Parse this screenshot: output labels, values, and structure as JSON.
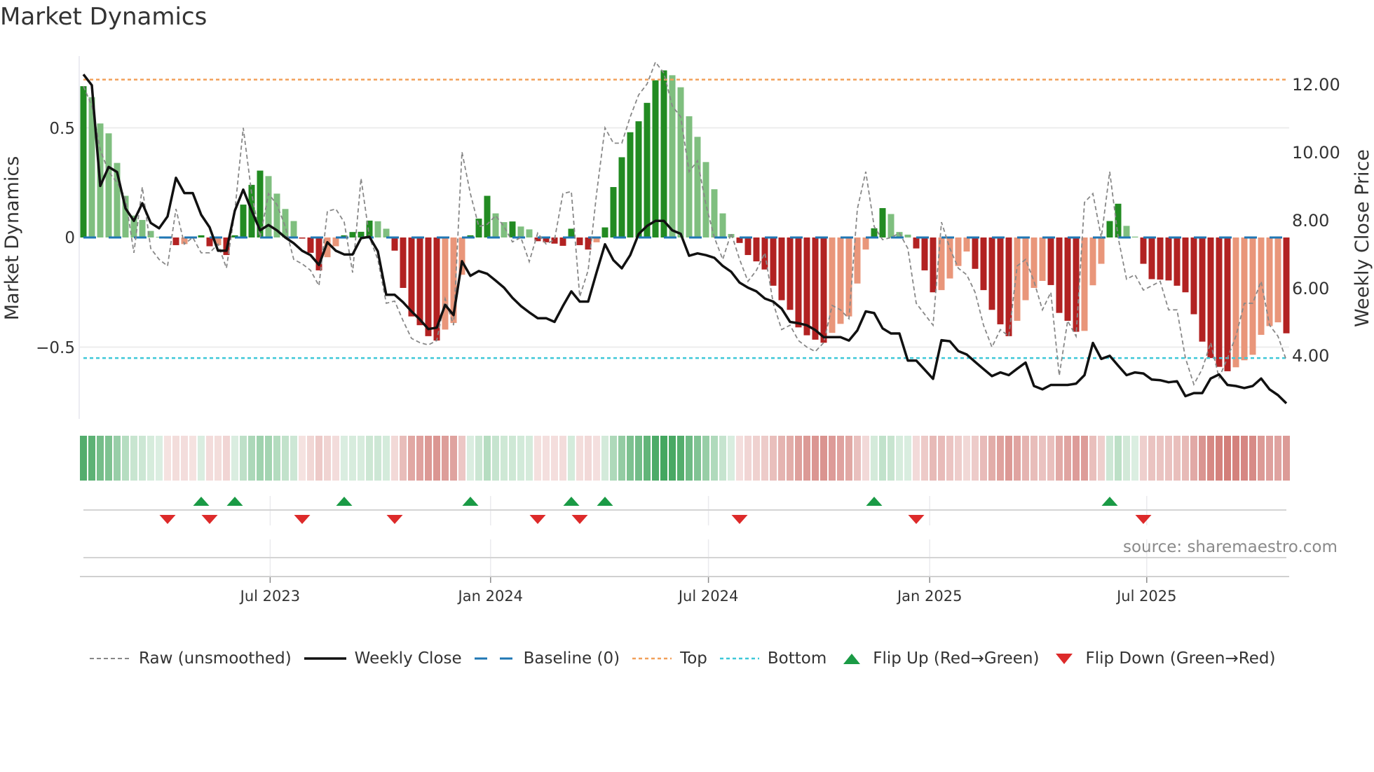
{
  "title": "Market Dynamics",
  "source": "source: sharemaestro.com",
  "colors": {
    "bar_up_strong": "#228b22",
    "bar_up_weak": "#7fbf7f",
    "bar_down_strong": "#b22222",
    "bar_down_weak": "#e9967a",
    "raw": "#888888",
    "close": "#111111",
    "baseline": "#1f77b4",
    "top": "#f2a05a",
    "bottom": "#3ec8d8",
    "flip_up": "#1a9a45",
    "flip_down": "#dd2a2a",
    "strip_green": "#3da35a",
    "strip_red": "#c8605a"
  },
  "legend": [
    {
      "key": "raw",
      "label": "Raw (unsmoothed)"
    },
    {
      "key": "close",
      "label": "Weekly Close"
    },
    {
      "key": "baseline",
      "label": "Baseline (0)"
    },
    {
      "key": "top",
      "label": "Top"
    },
    {
      "key": "bottom",
      "label": "Bottom"
    },
    {
      "key": "flip_up",
      "label": "Flip Up (Red→Green)"
    },
    {
      "key": "flip_down",
      "label": "Flip Down (Green→Red)"
    }
  ],
  "chart_data": {
    "type": "bar",
    "title": "Market Dynamics",
    "ylabel": "Market Dynamics",
    "y2label": "Weekly Close Price",
    "xlabel": "",
    "ylim": [
      -0.66,
      0.82
    ],
    "y2lim": [
      2.2,
      13.1
    ],
    "yticks": [
      {
        "value": 0.5,
        "label": "0.5"
      },
      {
        "value": 0,
        "label": "0"
      },
      {
        "value": -0.5,
        "label": "−0.5"
      }
    ],
    "y2ticks": [
      {
        "value": 12,
        "label": "12.00"
      },
      {
        "value": 10,
        "label": "10.00"
      },
      {
        "value": 8,
        "label": "8.00"
      },
      {
        "value": 6,
        "label": "6.00"
      },
      {
        "value": 4,
        "label": "4.00"
      }
    ],
    "xticks": [
      {
        "week": 22.2,
        "label": "Jul 2023"
      },
      {
        "week": 48.4,
        "label": "Jan 2024"
      },
      {
        "week": 74.3,
        "label": "Jul 2024"
      },
      {
        "week": 100.6,
        "label": "Jan 2025"
      },
      {
        "week": 126.4,
        "label": "Jul 2025"
      }
    ],
    "top_level": 0.72,
    "bottom_level": -0.55,
    "baseline": 0,
    "grid": true,
    "legend_position": "bottom",
    "momentum": [
      0.69,
      0.64,
      0.52,
      0.475,
      0.34,
      0.19,
      0.1,
      0.08,
      0.03,
      0.003,
      -0.005,
      -0.035,
      -0.03,
      -0.005,
      0.01,
      -0.04,
      -0.035,
      -0.08,
      0.01,
      0.15,
      0.24,
      0.305,
      0.28,
      0.2,
      0.13,
      0.075,
      -0.005,
      -0.07,
      -0.15,
      -0.09,
      -0.04,
      0.01,
      0.025,
      0.026,
      0.077,
      0.074,
      0.04,
      -0.06,
      -0.23,
      -0.36,
      -0.4,
      -0.45,
      -0.47,
      -0.42,
      -0.39,
      -0.17,
      0.01,
      0.086,
      0.19,
      0.11,
      0.07,
      0.073,
      0.05,
      0.037,
      -0.017,
      -0.022,
      -0.028,
      -0.038,
      0.04,
      -0.035,
      -0.055,
      -0.022,
      0.046,
      0.23,
      0.366,
      0.48,
      0.53,
      0.614,
      0.717,
      0.762,
      0.74,
      0.685,
      0.553,
      0.459,
      0.344,
      0.22,
      0.11,
      0.016,
      -0.025,
      -0.08,
      -0.109,
      -0.146,
      -0.22,
      -0.286,
      -0.33,
      -0.41,
      -0.446,
      -0.466,
      -0.48,
      -0.435,
      -0.394,
      -0.36,
      -0.21,
      -0.055,
      0.042,
      0.134,
      0.107,
      0.025,
      0.013,
      -0.05,
      -0.15,
      -0.25,
      -0.24,
      -0.187,
      -0.13,
      -0.064,
      -0.143,
      -0.24,
      -0.33,
      -0.396,
      -0.45,
      -0.38,
      -0.286,
      -0.23,
      -0.198,
      -0.217,
      -0.344,
      -0.38,
      -0.43,
      -0.426,
      -0.218,
      -0.12,
      0.075,
      0.154,
      0.053,
      0.004,
      -0.12,
      -0.19,
      -0.192,
      -0.196,
      -0.22,
      -0.25,
      -0.35,
      -0.475,
      -0.55,
      -0.59,
      -0.61,
      -0.592,
      -0.56,
      -0.535,
      -0.444,
      -0.404,
      -0.387,
      -0.437
    ],
    "raw": [
      0.69,
      0.6,
      0.4,
      0.3,
      0.25,
      0.18,
      -0.07,
      0.23,
      -0.05,
      -0.1,
      -0.13,
      0.13,
      -0.03,
      0.0,
      -0.07,
      -0.07,
      -0.03,
      -0.14,
      0.12,
      0.5,
      0.2,
      0.0,
      0.2,
      0.15,
      0.05,
      -0.1,
      -0.12,
      -0.15,
      -0.22,
      0.12,
      0.13,
      0.07,
      -0.16,
      0.27,
      0.0,
      -0.1,
      -0.3,
      -0.29,
      -0.38,
      -0.46,
      -0.48,
      -0.49,
      -0.47,
      -0.28,
      -0.4,
      0.39,
      0.2,
      0.05,
      0.06,
      0.1,
      0.05,
      -0.02,
      0.0,
      -0.11,
      0.02,
      -0.03,
      -0.01,
      0.2,
      0.21,
      -0.27,
      -0.15,
      0.2,
      0.5,
      0.43,
      0.43,
      0.55,
      0.65,
      0.7,
      0.8,
      0.75,
      0.6,
      0.55,
      0.3,
      0.35,
      0.15,
      0.0,
      -0.1,
      0.02,
      -0.1,
      -0.2,
      -0.15,
      -0.07,
      -0.3,
      -0.42,
      -0.4,
      -0.47,
      -0.5,
      -0.52,
      -0.48,
      -0.31,
      -0.33,
      -0.37,
      0.13,
      0.3,
      0.05,
      -0.01,
      0.0,
      0.02,
      -0.05,
      -0.3,
      -0.35,
      -0.4,
      0.07,
      -0.05,
      -0.14,
      -0.17,
      -0.25,
      -0.4,
      -0.5,
      -0.42,
      -0.45,
      -0.13,
      -0.1,
      -0.2,
      -0.33,
      -0.25,
      -0.63,
      -0.38,
      -0.45,
      0.16,
      0.2,
      0.0,
      0.3,
      0.0,
      -0.19,
      -0.17,
      -0.24,
      -0.22,
      -0.2,
      -0.33,
      -0.33,
      -0.55,
      -0.67,
      -0.6,
      -0.48,
      -0.64,
      -0.55,
      -0.45,
      -0.3,
      -0.3,
      -0.2,
      -0.4,
      -0.45,
      -0.56
    ],
    "weekly_close": [
      12.3,
      11.98,
      9.01,
      9.57,
      9.42,
      8.35,
      7.98,
      8.5,
      7.92,
      7.76,
      8.11,
      9.25,
      8.8,
      8.8,
      8.16,
      7.79,
      7.1,
      7.1,
      8.28,
      8.9,
      8.28,
      7.7,
      7.86,
      7.7,
      7.49,
      7.32,
      7.1,
      6.97,
      6.68,
      7.35,
      7.1,
      6.99,
      6.99,
      7.47,
      7.51,
      7.08,
      5.8,
      5.8,
      5.58,
      5.31,
      5.07,
      4.79,
      4.83,
      5.5,
      5.2,
      6.79,
      6.36,
      6.5,
      6.42,
      6.22,
      6.01,
      5.71,
      5.47,
      5.28,
      5.11,
      5.11,
      5.0,
      5.47,
      5.9,
      5.6,
      5.6,
      6.46,
      7.29,
      6.82,
      6.58,
      6.97,
      7.59,
      7.83,
      7.98,
      7.98,
      7.7,
      7.6,
      6.95,
      7.02,
      6.97,
      6.89,
      6.65,
      6.48,
      6.16,
      6.01,
      5.9,
      5.69,
      5.6,
      5.39,
      5.0,
      4.96,
      4.9,
      4.76,
      4.55,
      4.55,
      4.55,
      4.45,
      4.75,
      5.31,
      5.26,
      4.81,
      4.66,
      4.66,
      3.86,
      3.86,
      3.59,
      3.32,
      4.46,
      4.43,
      4.14,
      4.04,
      3.82,
      3.61,
      3.4,
      3.51,
      3.43,
      3.62,
      3.8,
      3.11,
      3.01,
      3.14,
      3.14,
      3.14,
      3.18,
      3.43,
      4.38,
      3.91,
      4.0,
      3.71,
      3.43,
      3.51,
      3.48,
      3.3,
      3.28,
      3.22,
      3.25,
      2.81,
      2.9,
      2.9,
      3.33,
      3.45,
      3.14,
      3.11,
      3.05,
      3.11,
      3.33,
      3.01,
      2.84,
      2.6
    ],
    "flip_up_weeks": [
      14,
      18,
      31,
      46,
      58,
      62,
      94,
      122
    ],
    "flip_down_weeks": [
      10,
      15,
      26,
      37,
      54,
      59,
      78,
      99,
      126
    ]
  }
}
